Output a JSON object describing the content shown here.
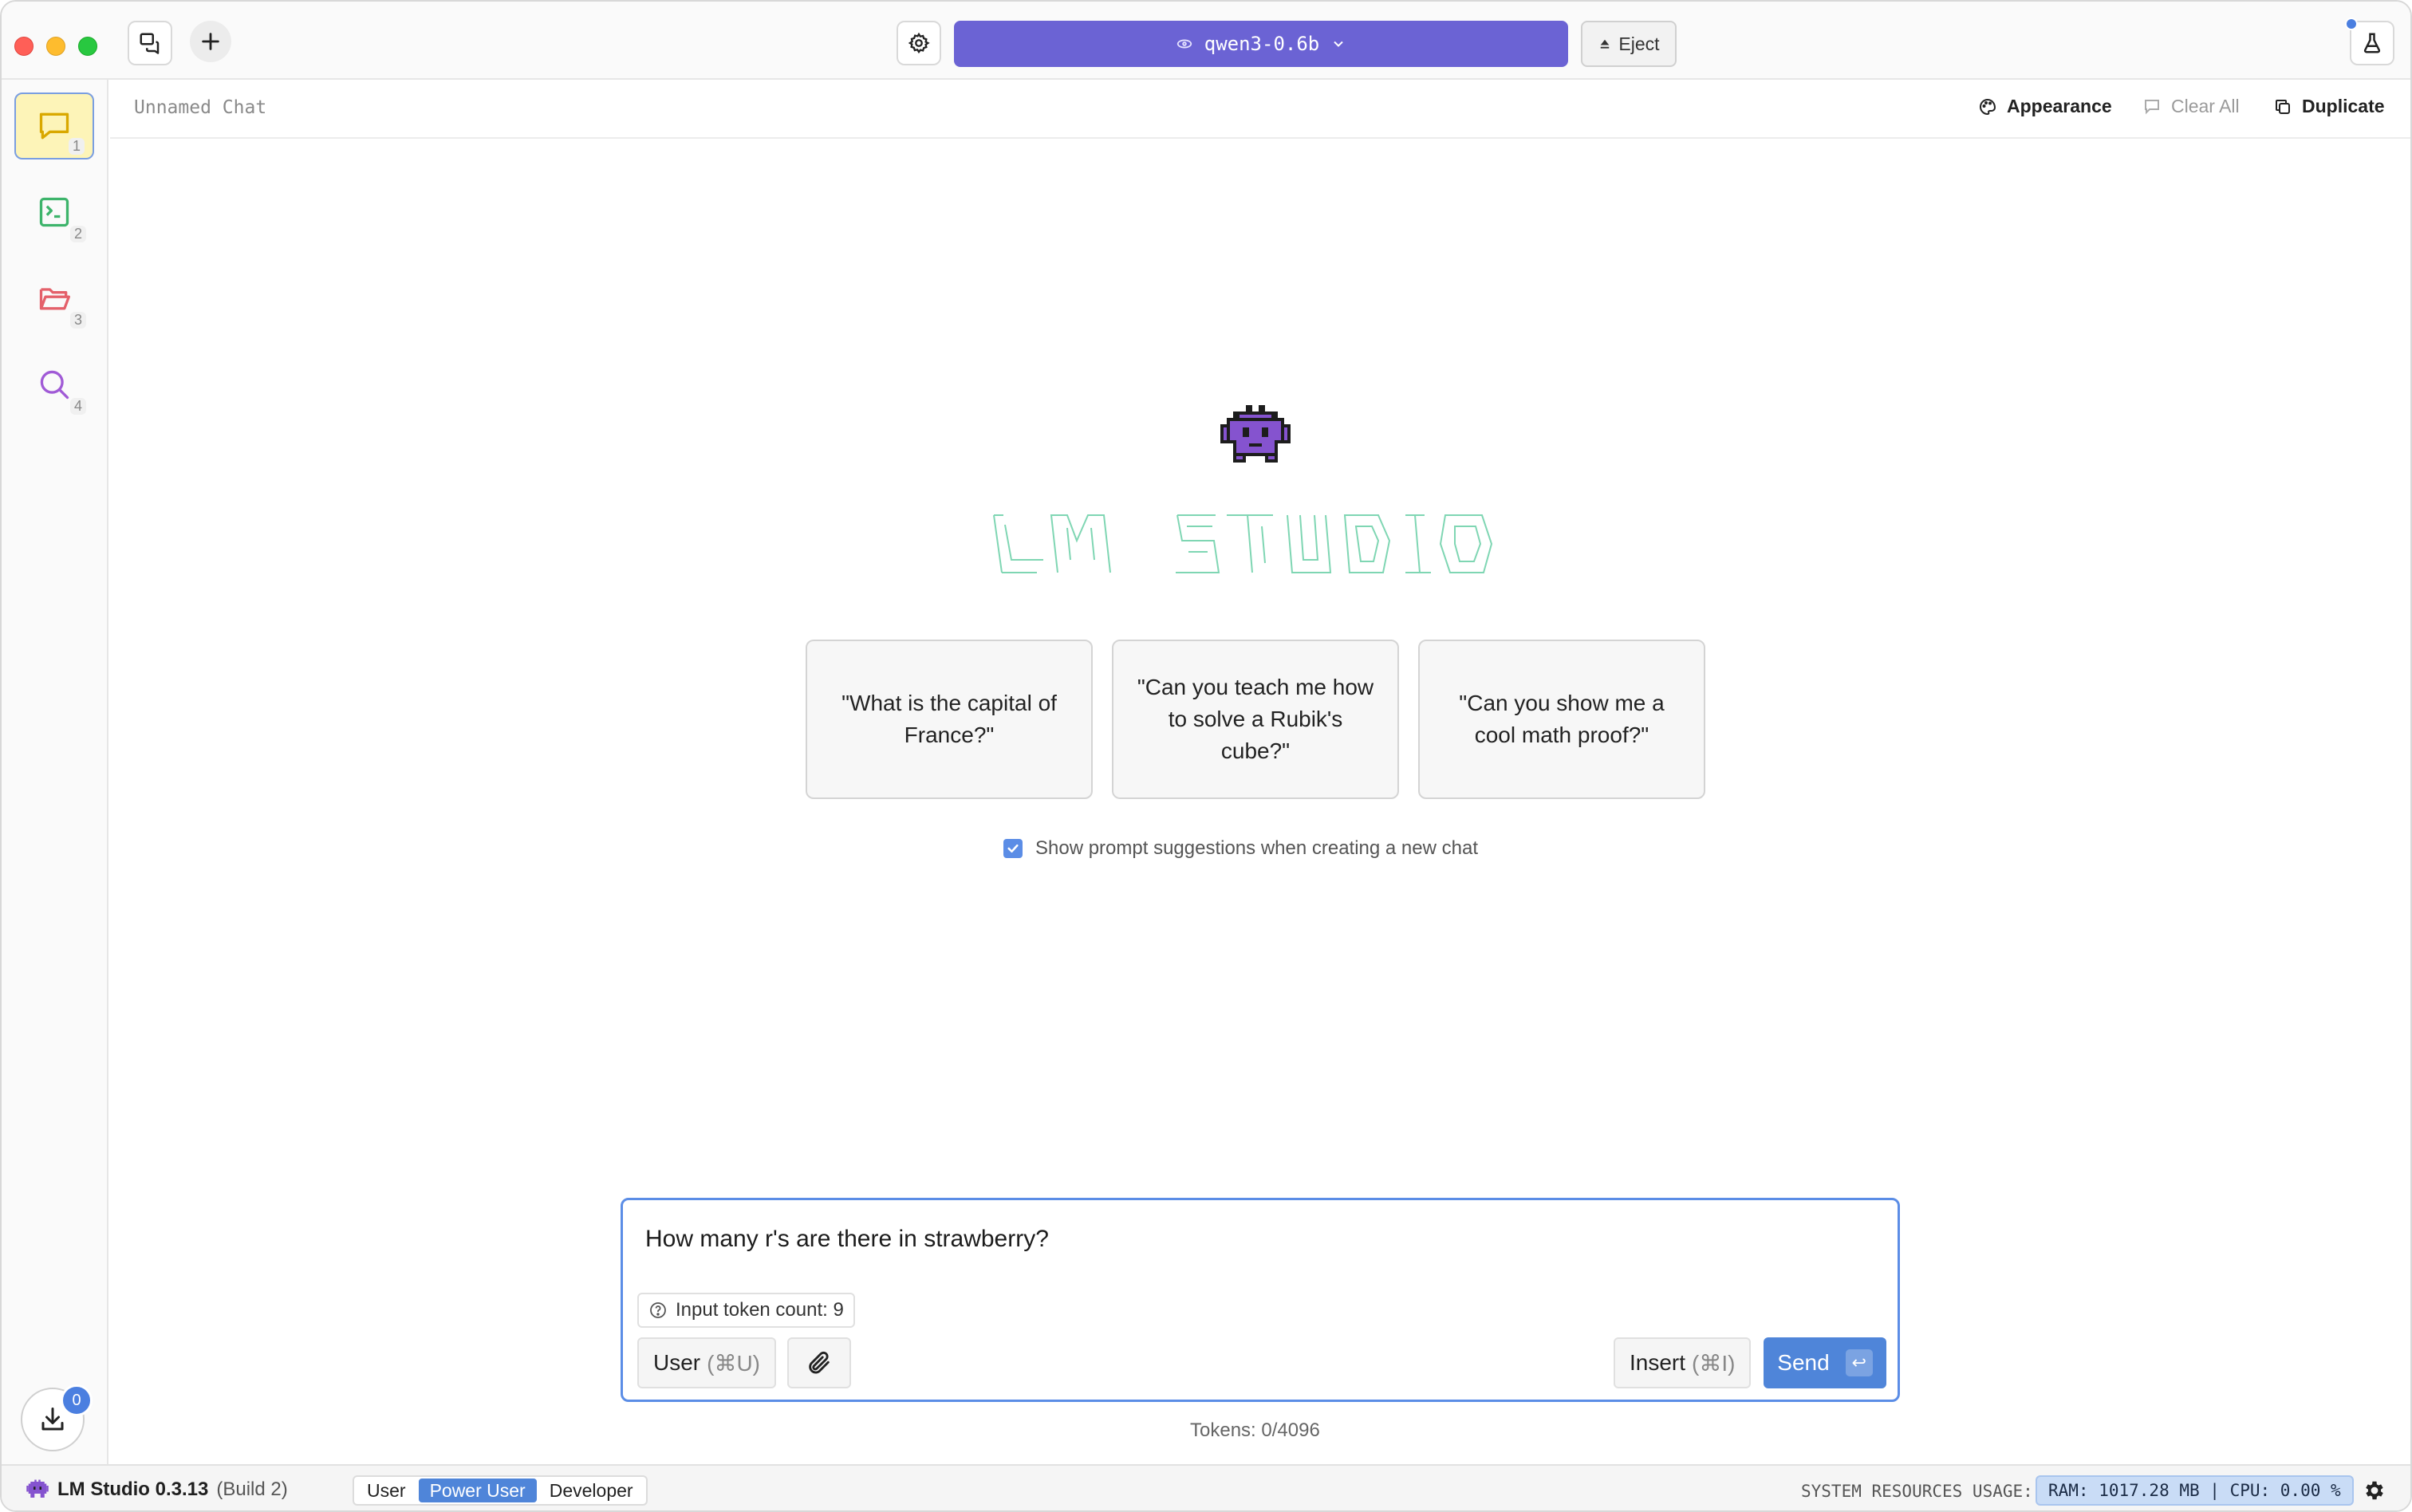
{
  "topbar": {
    "model_name": "qwen3-0.6b",
    "eject_label": "Eject"
  },
  "sidebar": {
    "items": [
      {
        "name": "chat",
        "num": "1",
        "color": "#e8b400"
      },
      {
        "name": "developer",
        "num": "2",
        "color": "#3db46b"
      },
      {
        "name": "my-models",
        "num": "3",
        "color": "#e4606a"
      },
      {
        "name": "discover",
        "num": "4",
        "color": "#a05ad6"
      }
    ],
    "downloads_count": "0"
  },
  "chat_header": {
    "title": "Unnamed Chat",
    "appearance_label": "Appearance",
    "clear_all_label": "Clear All",
    "duplicate_label": "Duplicate"
  },
  "suggestions": [
    "\"What is the capital of France?\"",
    "\"Can you teach me how to solve a Rubik's cube?\"",
    "\"Can you show me a cool math proof?\""
  ],
  "show_suggestions_label": "Show prompt suggestions when creating a new chat",
  "composer": {
    "text": "How many r's are there in strawberry?",
    "token_count_label": "Input token count: 9",
    "role_label": "User",
    "role_shortcut": "(⌘U)",
    "insert_label": "Insert",
    "insert_shortcut": "(⌘I)",
    "send_label": "Send",
    "send_key": "↩"
  },
  "tokens_total": "Tokens: 0/4096",
  "statusbar": {
    "app_name": "LM Studio 0.3.13",
    "build": "(Build 2)",
    "modes": [
      "User",
      "Power User",
      "Developer"
    ],
    "active_mode": "Power User",
    "resources_label": "SYSTEM RESOURCES USAGE:",
    "resources_value": "RAM: 1017.28 MB | CPU: 0.00 %"
  },
  "colors": {
    "accent": "#4f85d9",
    "model_bar": "#6b63d4",
    "mascot": "#7b4cc4",
    "ascii_logo": "#7fd6b3"
  }
}
